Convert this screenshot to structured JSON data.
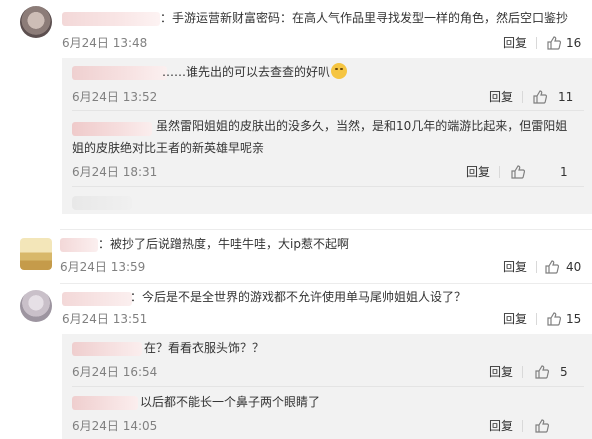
{
  "comments": [
    {
      "text": "：手游运营新财富密码：在高人气作品里寻找发型一样的角色，然后空口鉴抄",
      "date": "6月24日 13:48",
      "reply_label": "回复",
      "likes": "16",
      "replies": [
        {
          "text": "……谁先出的可以去查查的好叭",
          "emoji": "shy-face-emoji",
          "date": "6月24日 13:52",
          "reply_label": "回复",
          "likes": "11"
        },
        {
          "text_line1": "虽然雷阳姐姐的皮肤出的没多久，当然，是和10几年的端游比起来，但雷阳姐",
          "text_line2": "姐的皮肤绝对比王者的新英雄早呢亲",
          "date": "6月24日 18:31",
          "reply_label": "回复",
          "likes": "1"
        }
      ]
    },
    {
      "text": "：被抄了后说蹭热度，牛哇牛哇，大ip惹不起啊",
      "date": "6月24日 13:59",
      "reply_label": "回复",
      "likes": "40"
    },
    {
      "text": "：今后是不是全世界的游戏都不允许使用单马尾帅姐姐人设了？",
      "date": "6月24日 13:51",
      "reply_label": "回复",
      "likes": "15",
      "replies": [
        {
          "text": "在？看看衣服头饰？？",
          "date": "6月24日 16:54",
          "reply_label": "回复",
          "likes": "5"
        },
        {
          "text": "以后都不能长一个鼻子两个眼睛了",
          "date": "6月24日 14:05",
          "reply_label": "回复",
          "likes": ""
        }
      ]
    }
  ],
  "icons": {
    "like": "thumbs-up-icon"
  },
  "colors": {
    "text": "#333333",
    "meta": "#808080",
    "sub_bg": "#f2f2f2"
  }
}
